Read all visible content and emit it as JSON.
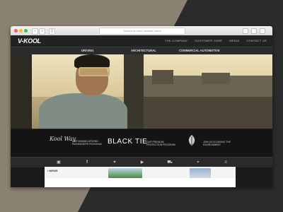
{
  "colors": {
    "background": "#8a8373",
    "dark_band": "#2b2b2b",
    "site_bg": "#1b1b1b"
  },
  "browser": {
    "url_placeholder": "Search or enter website name"
  },
  "header": {
    "logo": "V-KOOL",
    "nav": [
      "THE COMPANY",
      "CUSTOMER CARE",
      "MEDIA",
      "CONTACT US"
    ]
  },
  "subnav": {
    "items": [
      "DRIVING",
      "ARCHITECTURAL",
      "COMMERCIAL AUTOMOTIVE"
    ]
  },
  "partners": [
    {
      "logo_text": "Kool Way",
      "text": "OUR WOMAN DRIVING PASSENGERS PROGRAM"
    },
    {
      "logo_text": "BLACK TIE",
      "text": "OUR PREMIUM PROTECTION PROGRAM"
    },
    {
      "logo_text": "",
      "text": "JOIN US IN SAVING THE ENVIRONMENT"
    }
  ],
  "news": {
    "label": "NEWS"
  },
  "icons": [
    "app-window-icon",
    "facebook-icon",
    "twitter-icon",
    "youtube-icon",
    "car-icon",
    "location-pin-icon",
    "list-icon"
  ]
}
